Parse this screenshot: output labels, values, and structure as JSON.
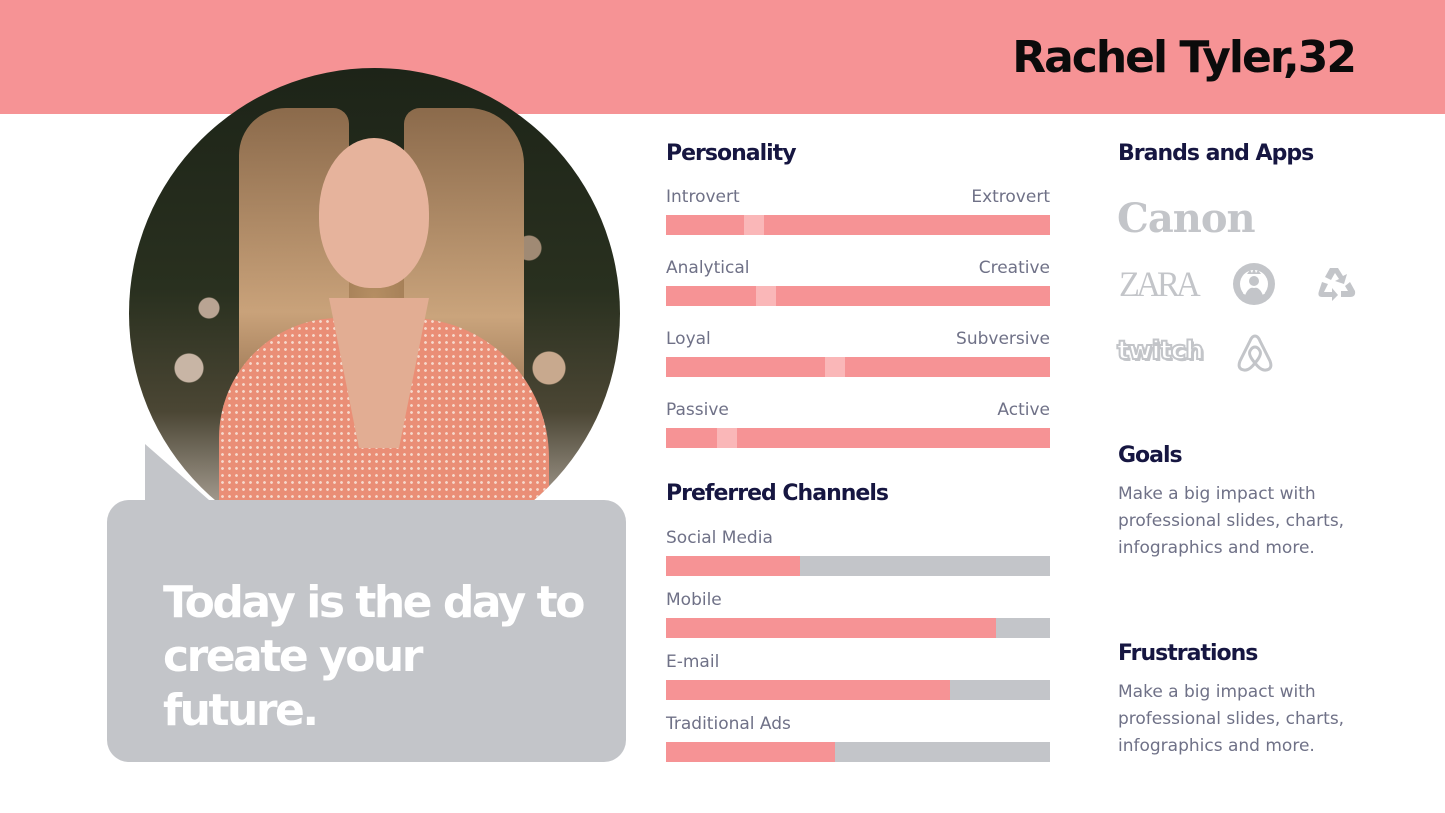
{
  "header": {
    "persona_name": "Rachel Tyler,32",
    "band_color": "#f69395"
  },
  "photo": {
    "alt": "Portrait of Rachel Tyler"
  },
  "quote": {
    "text": "Today is the day to create your future."
  },
  "personality": {
    "title": "Personality",
    "traits": [
      {
        "left": "Introvert",
        "right": "Extrovert",
        "position": 0.23
      },
      {
        "left": "Analytical",
        "right": "Creative",
        "position": 0.26
      },
      {
        "left": "Loyal",
        "right": "Subversive",
        "position": 0.44
      },
      {
        "left": "Passive",
        "right": "Active",
        "position": 0.16
      }
    ]
  },
  "channels": {
    "title": "Preferred Channels",
    "items": [
      {
        "label": "Social Media",
        "value": 0.35
      },
      {
        "label": "Mobile",
        "value": 0.86
      },
      {
        "label": "E-mail",
        "value": 0.74
      },
      {
        "label": "Traditional Ads",
        "value": 0.44
      }
    ]
  },
  "brands": {
    "title": "Brands and Apps",
    "logos": [
      {
        "name": "Canon",
        "icon": "canon-logo",
        "text": "Canon"
      },
      {
        "name": "Zara",
        "icon": "zara-logo",
        "text": "ZARA"
      },
      {
        "name": "Starbucks",
        "icon": "starbucks-logo"
      },
      {
        "name": "Recycle",
        "icon": "recycle-icon"
      },
      {
        "name": "Twitch",
        "icon": "twitch-logo",
        "text": "twitch"
      },
      {
        "name": "Airbnb",
        "icon": "airbnb-logo"
      }
    ]
  },
  "goals": {
    "title": "Goals",
    "text": "Make a big impact with professional slides, charts, infographics and more."
  },
  "frustrations": {
    "title": "Frustrations",
    "text": "Make a big impact with professional slides, charts, infographics and more."
  },
  "colors": {
    "accent": "#f69395",
    "accent_light": "#fab7b8",
    "neutral": "#c3c5c9",
    "heading": "#161641",
    "body": "#6f7187"
  }
}
